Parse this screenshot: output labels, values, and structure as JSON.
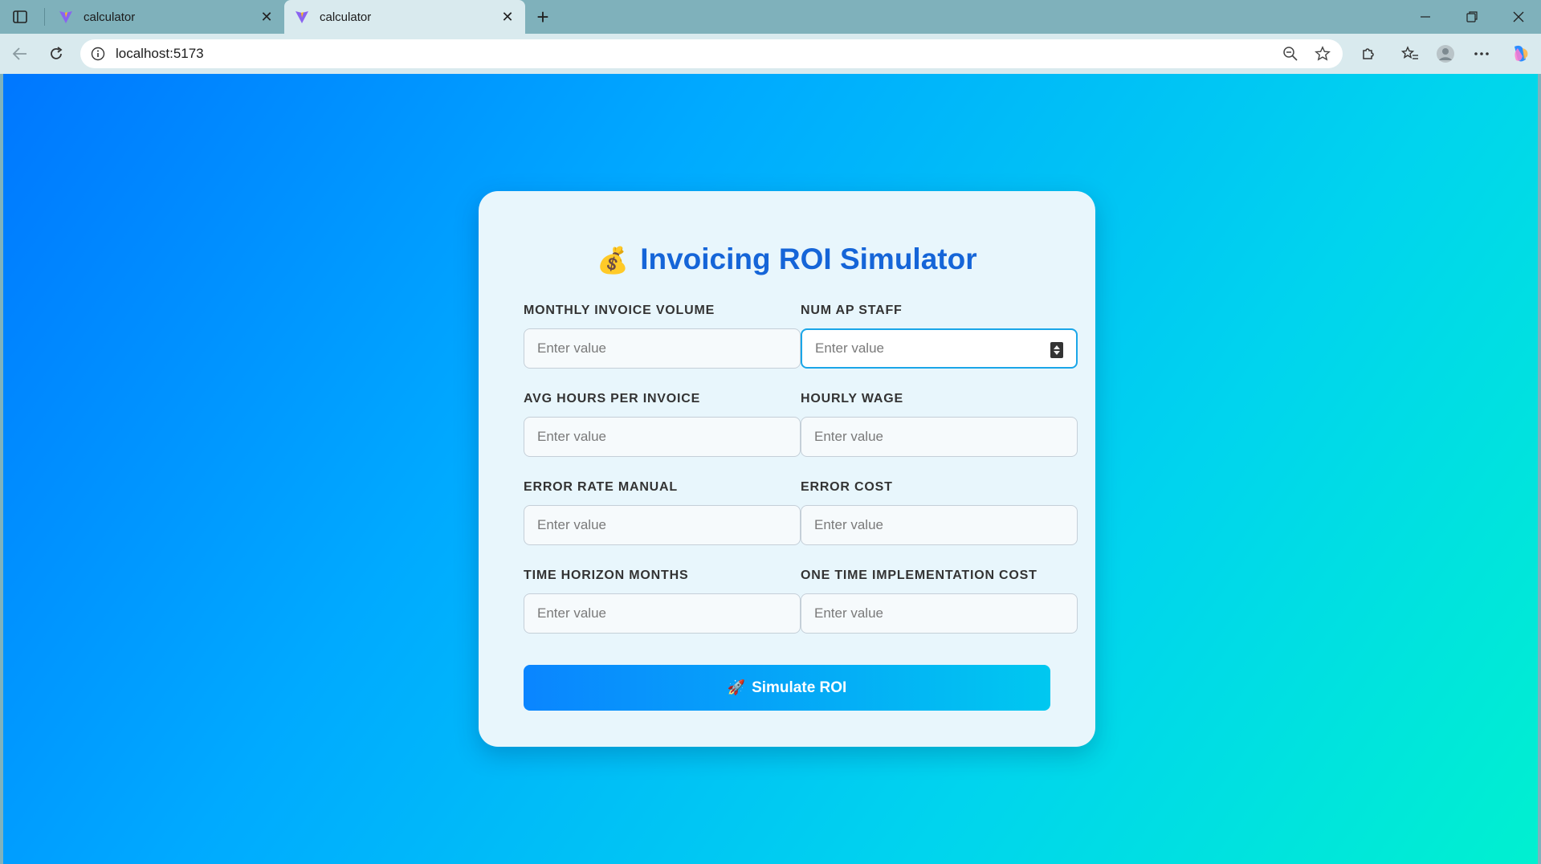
{
  "browser": {
    "tabs": [
      {
        "title": "calculator",
        "active": false
      },
      {
        "title": "calculator",
        "active": true
      }
    ],
    "url": "localhost:5173"
  },
  "app": {
    "title_emoji": "💰",
    "title": "Invoicing ROI Simulator",
    "fields": [
      {
        "label": "MONTHLY INVOICE VOLUME",
        "placeholder": "Enter value",
        "value": ""
      },
      {
        "label": "NUM AP STAFF",
        "placeholder": "Enter value",
        "value": "",
        "focused": true
      },
      {
        "label": "AVG HOURS PER INVOICE",
        "placeholder": "Enter value",
        "value": ""
      },
      {
        "label": "HOURLY WAGE",
        "placeholder": "Enter value",
        "value": ""
      },
      {
        "label": "ERROR RATE MANUAL",
        "placeholder": "Enter value",
        "value": ""
      },
      {
        "label": "ERROR COST",
        "placeholder": "Enter value",
        "value": ""
      },
      {
        "label": "TIME HORIZON MONTHS",
        "placeholder": "Enter value",
        "value": ""
      },
      {
        "label": "ONE TIME IMPLEMENTATION COST",
        "placeholder": "Enter value",
        "value": ""
      }
    ],
    "button_emoji": "🚀",
    "button_label": "Simulate ROI"
  },
  "colors": {
    "accent": "#1565d8",
    "focus": "#1aa6e8"
  }
}
